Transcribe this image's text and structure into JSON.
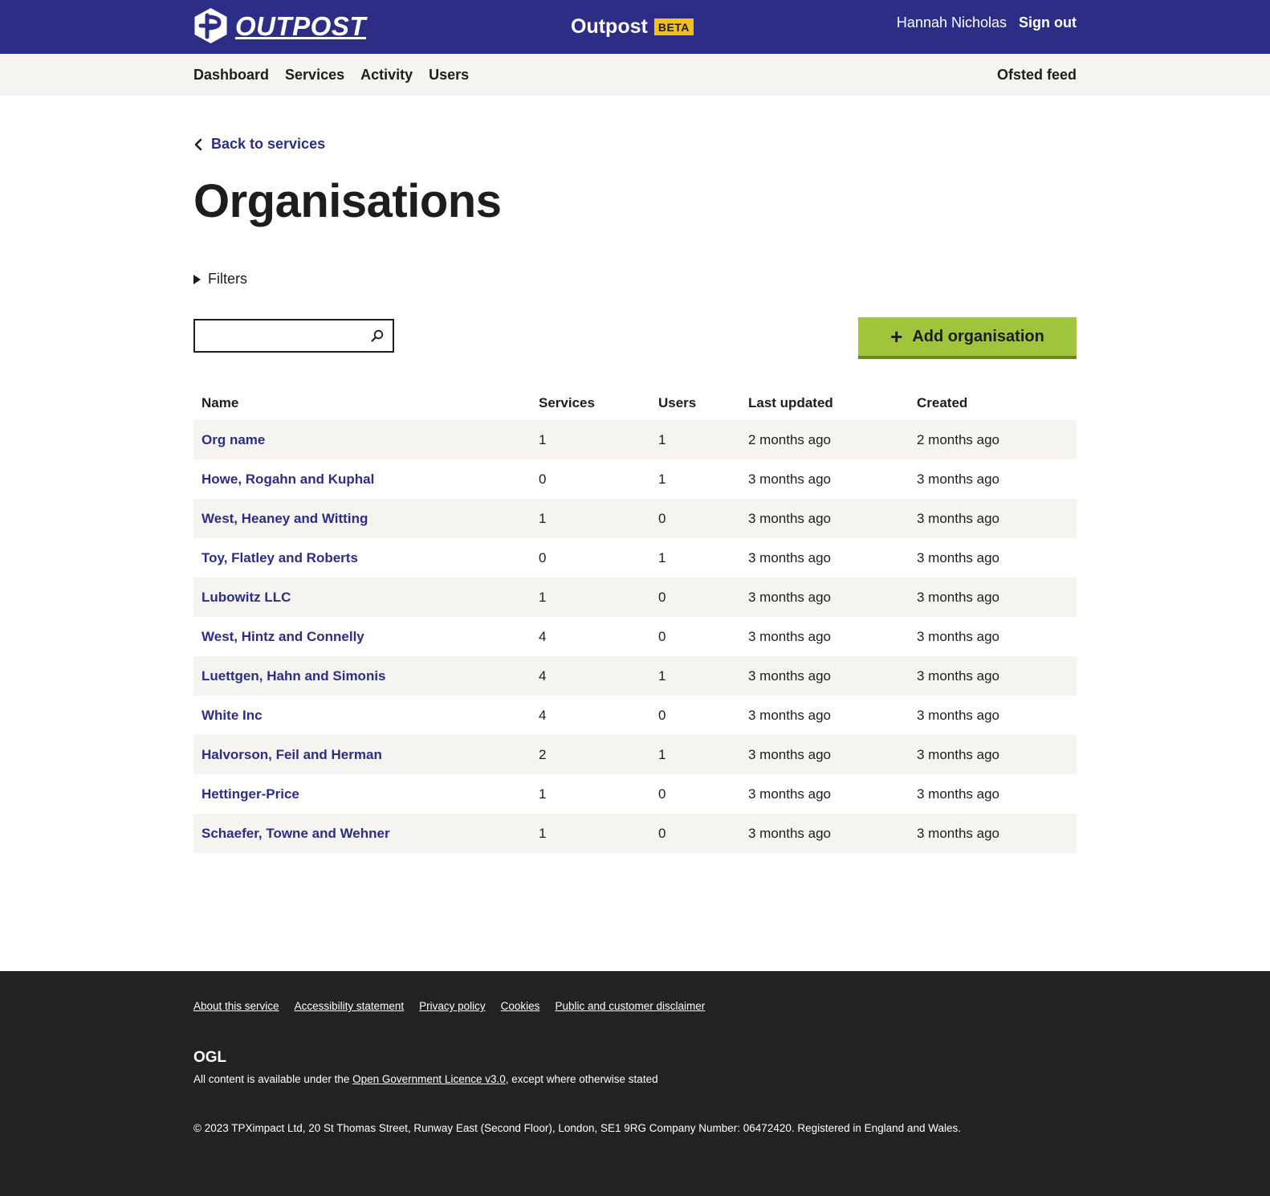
{
  "header": {
    "logo_text": "OUTPOST",
    "service_title": "Outpost",
    "beta_label": "BETA",
    "user_name": "Hannah Nicholas",
    "sign_out_label": "Sign out"
  },
  "nav": {
    "items": [
      {
        "label": "Dashboard"
      },
      {
        "label": "Services"
      },
      {
        "label": "Activity"
      },
      {
        "label": "Users"
      }
    ],
    "right_label": "Ofsted feed"
  },
  "main": {
    "back_label": "Back to services",
    "title": "Organisations",
    "filters_label": "Filters",
    "search": {
      "value": "",
      "placeholder": ""
    },
    "add_label": "Add organisation"
  },
  "table": {
    "headers": [
      "Name",
      "Services",
      "Users",
      "Last updated",
      "Created"
    ],
    "rows": [
      {
        "name": "Org name",
        "services": "1",
        "users": "1",
        "updated": "2 months ago",
        "created": "2 months ago"
      },
      {
        "name": "Howe, Rogahn and Kuphal",
        "services": "0",
        "users": "1",
        "updated": "3 months ago",
        "created": "3 months ago"
      },
      {
        "name": "West, Heaney and Witting",
        "services": "1",
        "users": "0",
        "updated": "3 months ago",
        "created": "3 months ago"
      },
      {
        "name": "Toy, Flatley and Roberts",
        "services": "0",
        "users": "1",
        "updated": "3 months ago",
        "created": "3 months ago"
      },
      {
        "name": "Lubowitz LLC",
        "services": "1",
        "users": "0",
        "updated": "3 months ago",
        "created": "3 months ago"
      },
      {
        "name": "West, Hintz and Connelly",
        "services": "4",
        "users": "0",
        "updated": "3 months ago",
        "created": "3 months ago"
      },
      {
        "name": "Luettgen, Hahn and Simonis",
        "services": "4",
        "users": "1",
        "updated": "3 months ago",
        "created": "3 months ago"
      },
      {
        "name": "White Inc",
        "services": "4",
        "users": "0",
        "updated": "3 months ago",
        "created": "3 months ago"
      },
      {
        "name": "Halvorson, Feil and Herman",
        "services": "2",
        "users": "1",
        "updated": "3 months ago",
        "created": "3 months ago"
      },
      {
        "name": "Hettinger-Price",
        "services": "1",
        "users": "0",
        "updated": "3 months ago",
        "created": "3 months ago"
      },
      {
        "name": "Schaefer, Towne and Wehner",
        "services": "1",
        "users": "0",
        "updated": "3 months ago",
        "created": "3 months ago"
      }
    ]
  },
  "footer": {
    "links": [
      {
        "label": "About this service"
      },
      {
        "label": "Accessibility statement"
      },
      {
        "label": "Privacy policy"
      },
      {
        "label": "Cookies"
      },
      {
        "label": "Public and customer disclaimer"
      }
    ],
    "ogl_label": "OGL",
    "licence_prefix": "All content is available under the ",
    "licence_link": "Open Government Licence v3.0",
    "licence_suffix": ", except where otherwise stated",
    "copyright": "© 2023 TPXimpact Ltd, 20 St Thomas Street, Runway East (Second Floor), London, SE1 9RG Company Number: 06472420. Registered in England and Wales."
  },
  "colors": {
    "header_bg": "#2d2d86",
    "nav_bg": "#f5f4f1",
    "link": "#2d2d86",
    "beta": "#f2bf1d",
    "add_button": "#a0c43b",
    "footer_bg": "#222222"
  },
  "icons": {
    "logo": "outpost-logo-icon",
    "back": "chevron-left-icon",
    "filters": "triangle-right-icon",
    "search": "search-icon",
    "add": "plus-icon"
  }
}
